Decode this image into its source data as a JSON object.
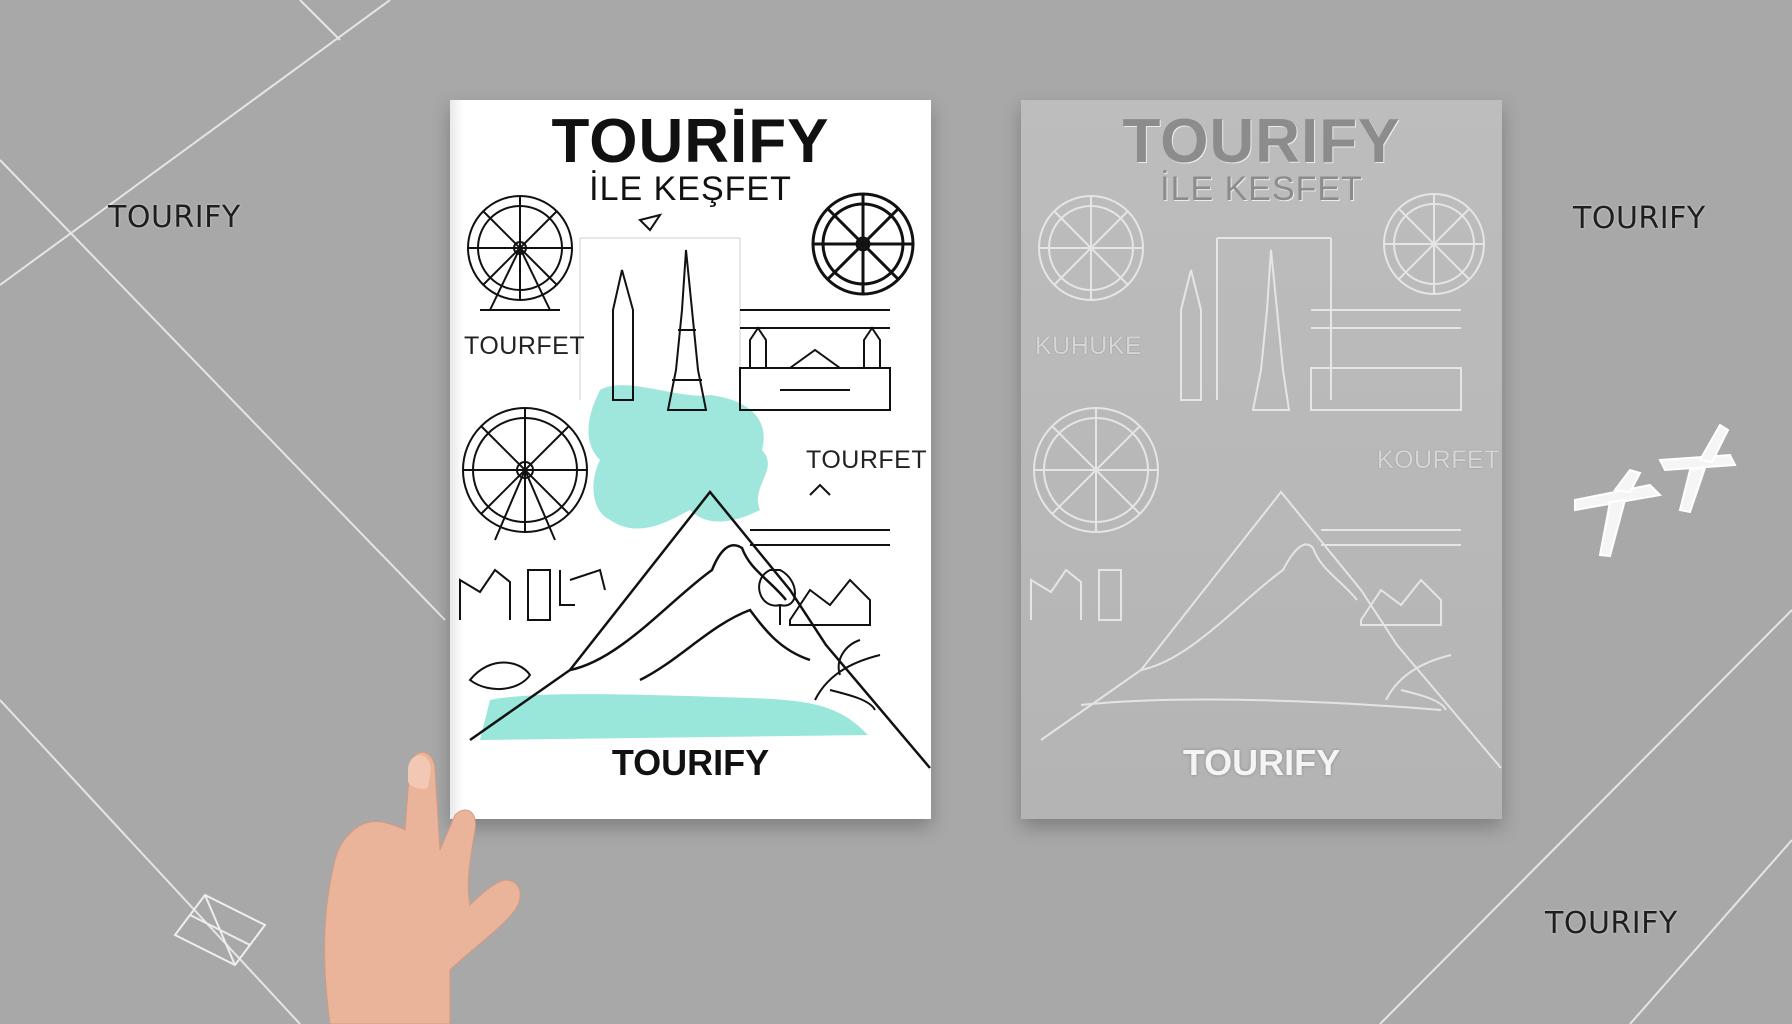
{
  "background": {
    "labels": [
      "TOURIFY",
      "TOURIFY",
      "TOURIFY"
    ],
    "color": "#a8a8a8"
  },
  "front_cover": {
    "title": "TOURİFY",
    "subtitle": "İLE KEŞFET",
    "sketch_label_1": "TOURFET",
    "sketch_label_2": "TOURFET",
    "bottom_brand": "TOURIFY",
    "accent_color": "#8ee3d6"
  },
  "back_cover": {
    "title": "TOURIFY",
    "subtitle": "İLE KESFET",
    "sketch_label_1": "KUHUKE",
    "sketch_label_2": "KOURFET",
    "bottom_brand": "TOURIFY"
  },
  "icons": [
    "ferris-wheel-icon",
    "tower-icon",
    "palace-icon",
    "mountain-icon",
    "airplane-icon",
    "kite-icon",
    "hand-icon"
  ]
}
